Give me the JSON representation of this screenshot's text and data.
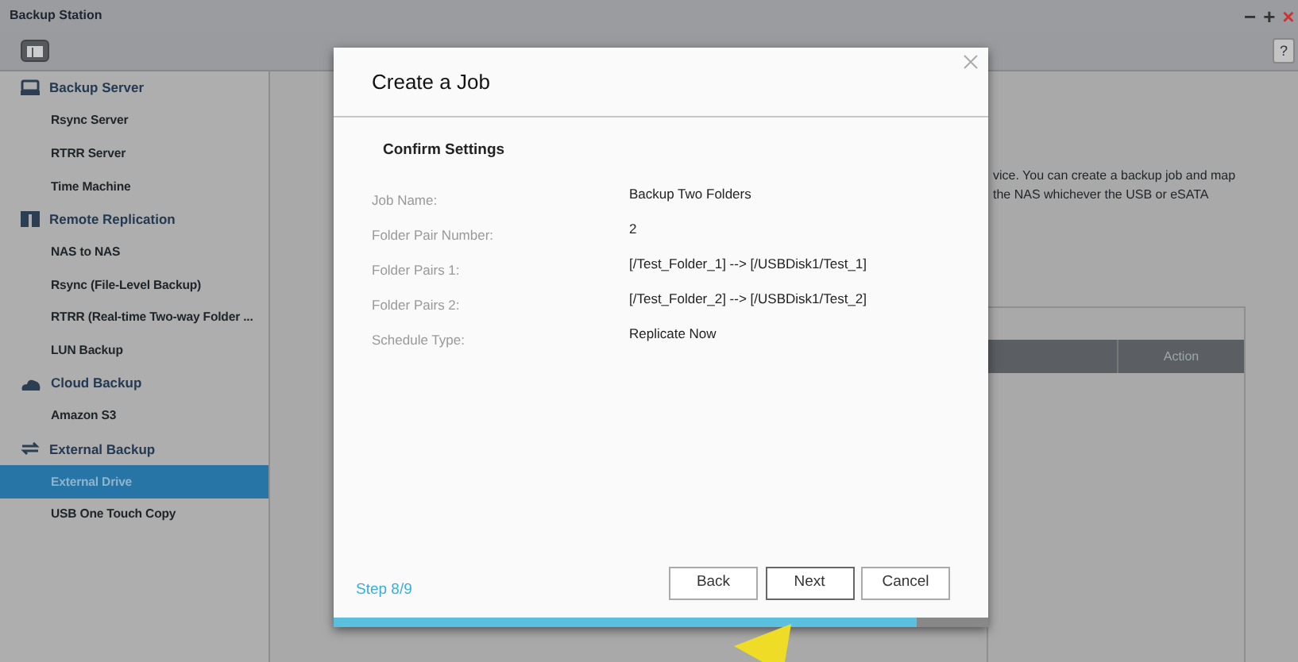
{
  "window": {
    "title": "Backup Station",
    "controls": [
      "−",
      "+",
      "×"
    ],
    "help": "?"
  },
  "sidebar": {
    "groups": [
      {
        "label": "Backup Server",
        "children": [
          {
            "label": "Rsync Server",
            "selected": false
          },
          {
            "label": "RTRR Server",
            "selected": false
          },
          {
            "label": "Time Machine",
            "selected": false
          }
        ]
      },
      {
        "label": "Remote Replication",
        "children": [
          {
            "label": "NAS to NAS",
            "selected": false
          },
          {
            "label": "Rsync (File-Level Backup)",
            "selected": false
          },
          {
            "label": "RTRR (Real-time Two-way Folder ...",
            "selected": false
          },
          {
            "label": "LUN Backup",
            "selected": false
          }
        ]
      },
      {
        "label": "Cloud Backup",
        "children": [
          {
            "label": "Amazon S3",
            "selected": false
          }
        ]
      },
      {
        "label": "External Backup",
        "children": [
          {
            "label": "External Drive",
            "selected": true
          },
          {
            "label": "USB One Touch Copy",
            "selected": false
          }
        ]
      }
    ]
  },
  "content": {
    "description": [
      "vice. You can create a backup job and map",
      "the NAS whichever the USB or eSATA"
    ],
    "table": {
      "columns": [
        "Action"
      ]
    }
  },
  "dialog": {
    "title": "Create a Job",
    "section": "Confirm Settings",
    "fields": [
      {
        "label": "Job Name:",
        "value": "Backup Two Folders"
      },
      {
        "label": "Folder Pair Number:",
        "value": "2"
      },
      {
        "label": "Folder Pairs 1:",
        "value": "[/Test_Folder_1] --> [/USBDisk1/Test_1]"
      },
      {
        "label": "Folder Pairs 2:",
        "value": "[/Test_Folder_2] --> [/USBDisk1/Test_2]"
      },
      {
        "label": "Schedule Type:",
        "value": "Replicate Now"
      }
    ],
    "step": "Step 8/9",
    "progress": {
      "level": 0.89
    },
    "buttons": [
      "Back",
      "Next",
      "Cancel"
    ]
  }
}
